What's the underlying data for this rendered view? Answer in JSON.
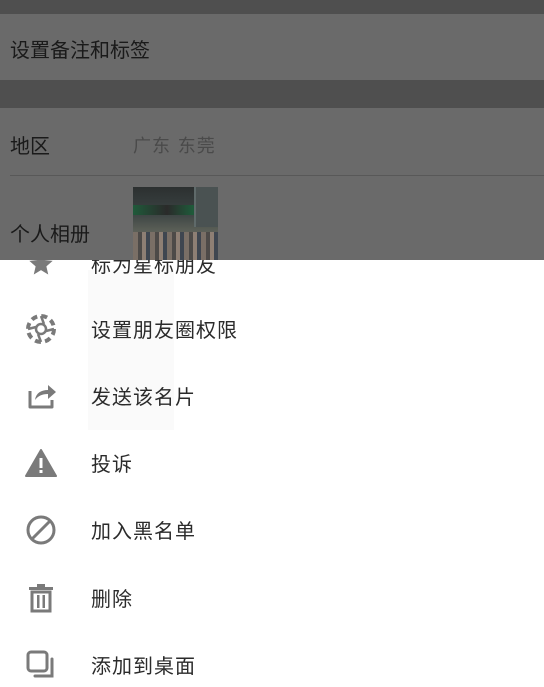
{
  "background_page": {
    "remark_label": "设置备注和标签",
    "region_label": "地区",
    "region_value": "广东  东莞",
    "album_label": "个人相册"
  },
  "menu": {
    "items": [
      {
        "label": "标为星标朋友",
        "icon": "star-icon"
      },
      {
        "label": "设置朋友圈权限",
        "icon": "aperture-icon"
      },
      {
        "label": "发送该名片",
        "icon": "share-icon"
      },
      {
        "label": "投诉",
        "icon": "warning-icon"
      },
      {
        "label": "加入黑名单",
        "icon": "block-icon"
      },
      {
        "label": "删除",
        "icon": "trash-icon"
      },
      {
        "label": "添加到桌面",
        "icon": "add-to-desktop-icon"
      }
    ]
  },
  "colors": {
    "overlay": "#5e5e5e",
    "sheet": "#ffffff",
    "icon": "#7a7a7a",
    "text": "#2b2b2b"
  }
}
